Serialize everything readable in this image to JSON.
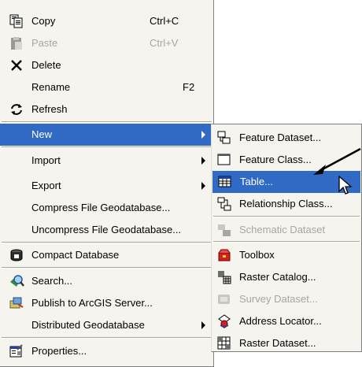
{
  "colors": {
    "menu_bg": "#f5f4ef",
    "highlight": "#316ac5",
    "disabled_text": "#a7a7a0"
  },
  "main_menu": {
    "copy": {
      "label": "Copy",
      "shortcut": "Ctrl+C",
      "icon": "copy-icon"
    },
    "paste": {
      "label": "Paste",
      "shortcut": "Ctrl+V",
      "icon": "paste-icon"
    },
    "delete": {
      "label": "Delete",
      "icon": "delete-x-icon"
    },
    "rename": {
      "label": "Rename",
      "shortcut": "F2"
    },
    "refresh": {
      "label": "Refresh",
      "icon": "refresh-icon"
    },
    "new": {
      "label": "New"
    },
    "import": {
      "label": "Import"
    },
    "export": {
      "label": "Export"
    },
    "compress": {
      "label": "Compress File Geodatabase..."
    },
    "uncompress": {
      "label": "Uncompress File Geodatabase..."
    },
    "compact": {
      "label": "Compact Database",
      "icon": "compact-database-icon"
    },
    "search": {
      "label": "Search...",
      "icon": "search-icon"
    },
    "publish": {
      "label": "Publish to ArcGIS Server...",
      "icon": "publish-icon"
    },
    "distributed": {
      "label": "Distributed Geodatabase"
    },
    "properties": {
      "label": "Properties...",
      "icon": "properties-icon"
    }
  },
  "new_submenu": {
    "feature_dataset": {
      "label": "Feature Dataset...",
      "icon": "feature-dataset-icon"
    },
    "feature_class": {
      "label": "Feature Class...",
      "icon": "feature-class-icon"
    },
    "table": {
      "label": "Table...",
      "icon": "table-icon"
    },
    "relationship_class": {
      "label": "Relationship Class...",
      "icon": "relationship-class-icon"
    },
    "schematic_dataset": {
      "label": "Schematic Dataset",
      "icon": "schematic-dataset-icon"
    },
    "toolbox": {
      "label": "Toolbox",
      "icon": "toolbox-icon"
    },
    "raster_catalog": {
      "label": "Raster Catalog...",
      "icon": "raster-catalog-icon"
    },
    "survey_dataset": {
      "label": "Survey Dataset...",
      "icon": "survey-dataset-icon"
    },
    "address_locator": {
      "label": "Address Locator...",
      "icon": "address-locator-icon"
    },
    "raster_dataset": {
      "label": "Raster Dataset...",
      "icon": "raster-dataset-icon"
    }
  }
}
